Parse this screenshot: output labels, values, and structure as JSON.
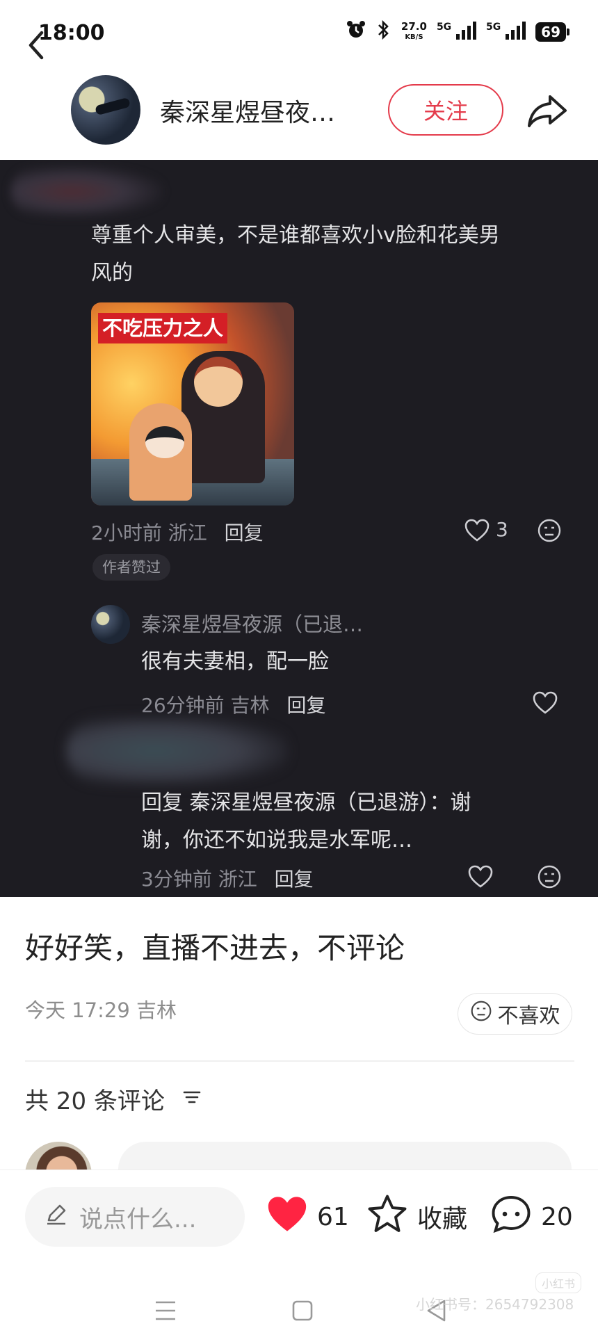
{
  "status_bar": {
    "time": "18:00",
    "speed_value": "27.0",
    "speed_unit": "KB/S",
    "net1": "5G",
    "net2": "5G",
    "battery": "69"
  },
  "header": {
    "back_icon": "chevron-left-icon",
    "author_name": "秦深星煜昼夜…",
    "follow_label": "关注",
    "share_icon": "share-arrow-icon"
  },
  "screenshot": {
    "comment1": {
      "text": "尊重个人审美，不是谁都喜欢小v脸和花美男风的",
      "line1": "尊重个人审美，不是谁都喜欢小v脸和花美男",
      "line2": "风的",
      "image_caption": "不吃压力之人",
      "time": "2小时前",
      "location": "浙江",
      "reply_label": "回复",
      "likes": "3",
      "author_liked": "作者赞过"
    },
    "reply1": {
      "name": "秦深星煜昼夜源（已退…",
      "text": "很有夫妻相，配一脸",
      "time": "26分钟前",
      "location": "吉林",
      "reply_label": "回复"
    },
    "reply2": {
      "line1": "回复 秦深星煜昼夜源（已退游）：谢",
      "line2": "谢，你还不如说我是水军呢…",
      "time": "3分钟前",
      "location": "浙江",
      "reply_label": "回复"
    }
  },
  "post": {
    "text": "好好笑，直播不进去，不评论",
    "meta": "今天 17:29 吉林",
    "dislike_label": "不喜欢",
    "comment_count": "共 20 条评论"
  },
  "bottom_bar": {
    "input_placeholder": "说点什么...",
    "likes": "61",
    "collect_label": "收藏",
    "comments": "20",
    "colors": {
      "like": "#ff2442",
      "follow": "#e43b4b"
    }
  },
  "watermark": {
    "text": "小红书号：2654792308",
    "logo": "小红书"
  }
}
